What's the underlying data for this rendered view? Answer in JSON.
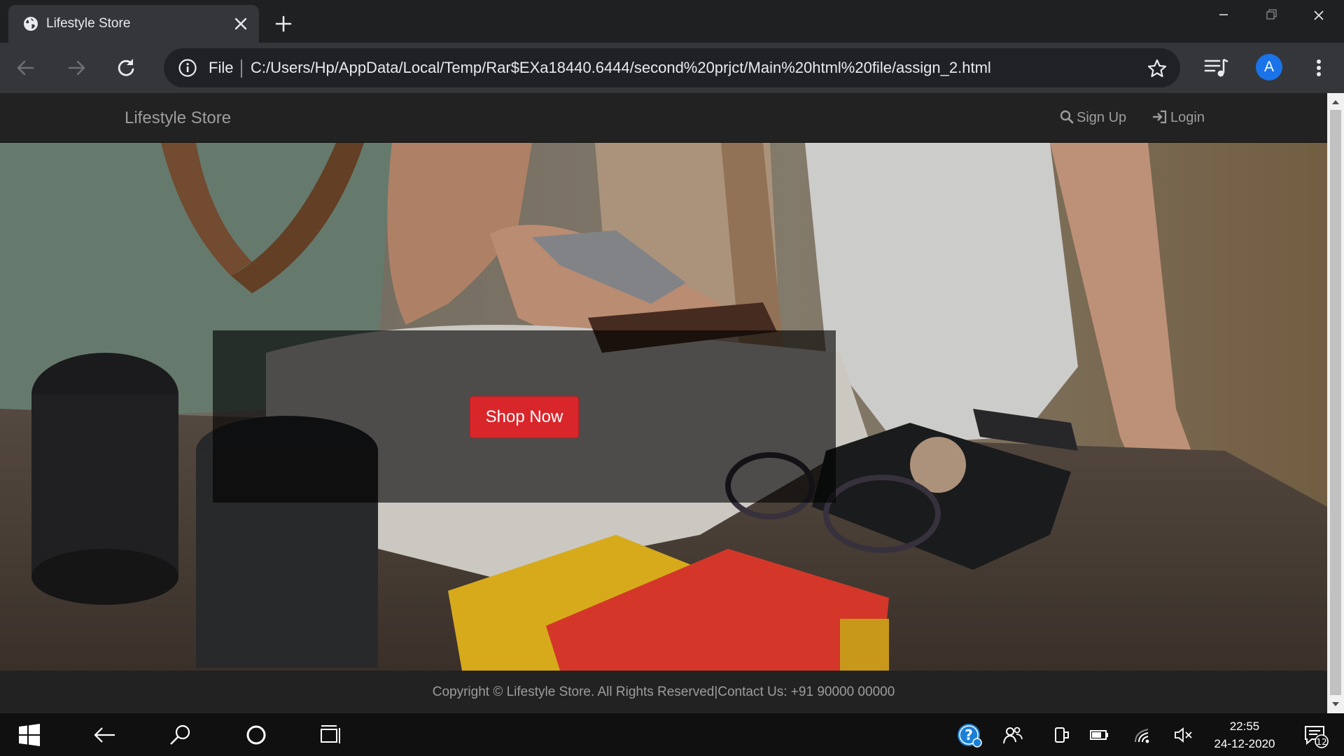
{
  "browser": {
    "tab_title": "Lifestyle Store",
    "address_scheme": "File",
    "address_url": "C:/Users/Hp/AppData/Local/Temp/Rar$EXa18440.6444/second%20prjct/Main%20html%20file/assign_2.html",
    "profile_initial": "A"
  },
  "site": {
    "brand": "Lifestyle Store",
    "nav": {
      "signup_label": "Sign Up",
      "login_label": "Login"
    },
    "hero": {
      "cta_label": "Shop Now"
    },
    "footer_text": "Copyright © Lifestyle Store. All Rights Reserved|Contact Us: +91 90000 00000"
  },
  "taskbar": {
    "time": "22:55",
    "date": "24-12-2020",
    "notification_count": "12"
  },
  "colors": {
    "navbar_bg": "#222222",
    "cta_red": "#d9262b",
    "chrome_dark": "#35363a",
    "avatar_blue": "#1a73e8"
  }
}
